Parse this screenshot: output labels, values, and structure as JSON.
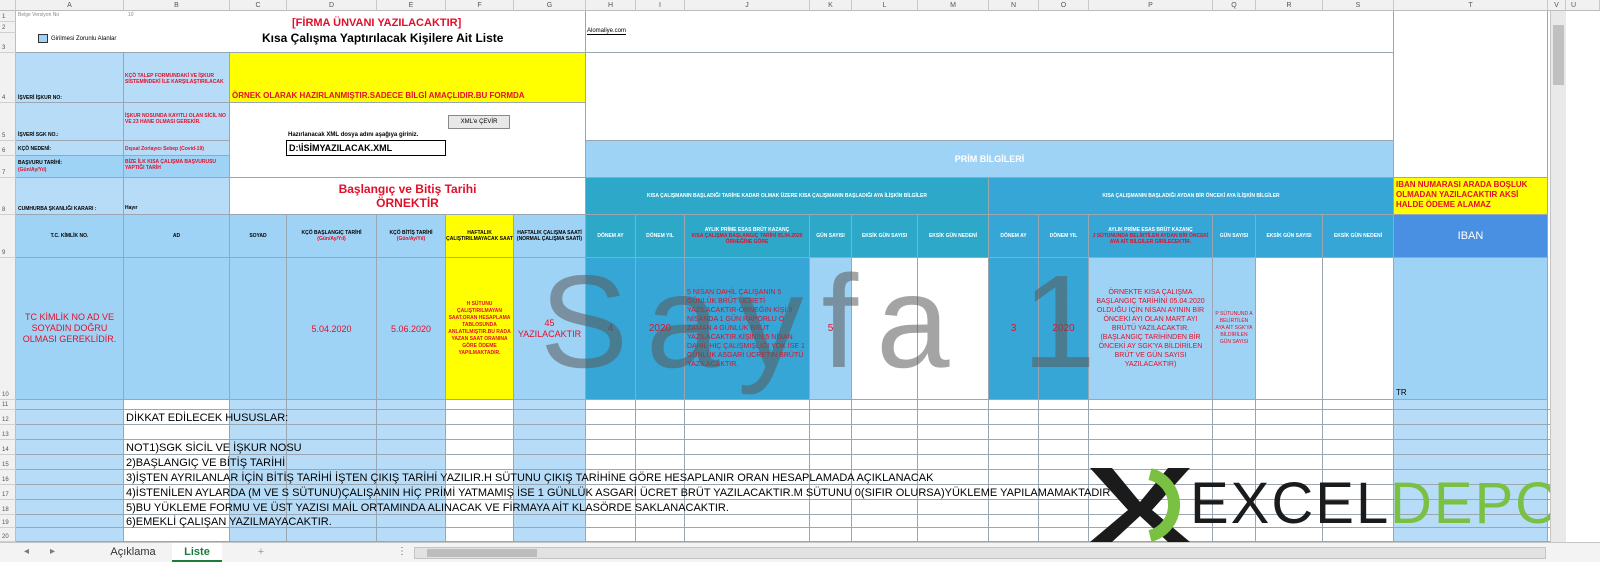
{
  "columns": [
    "A",
    "B",
    "C",
    "D",
    "E",
    "F",
    "G",
    "H",
    "I",
    "J",
    "K",
    "L",
    "M",
    "N",
    "O",
    "P",
    "Q",
    "R",
    "S",
    "T",
    "U",
    "V"
  ],
  "rows": [
    "1",
    "2",
    "3",
    "4",
    "5",
    "6",
    "7",
    "8",
    "9",
    "10",
    "11",
    "12",
    "13",
    "14",
    "15",
    "16",
    "17",
    "18",
    "19",
    "20"
  ],
  "header": {
    "tiny_top_label": "Belge Versiyon No",
    "tiny_top_value": "10",
    "required_legend": "Girilmesi Zorunlu Alanlar",
    "company_placeholder": "[FİRMA ÜNVANI YAZILACAKTIR]",
    "list_title": "Kısa Çalışma Yaptırılacak Kişilere Ait Liste",
    "site_link": "Alomaliye.com"
  },
  "left_labels": {
    "isveren_iskur_no": "İŞVERİ İŞKUR NO:",
    "isveren_sgk_no": "İŞVERİ SGK NO.:",
    "kco_nedeni": "KÇÖ NEDENİ:",
    "basvuru_tarihi": "BAŞVURU TARİHİ:",
    "basvuru_tarihi_sub": "(Gün/Ay/Yıl)",
    "cumhurbaskanligi": "CUMHURBA ŞKANLIĞI KARARI :"
  },
  "left_values": {
    "iskur_note": "KÇÖ TALEP FORMUNDAKİ VE İŞKUR SİSTEMİNDEKİ İLE KARŞILAŞTIRILACAK",
    "sgk_note": "İŞKUR NOSUNDA KAYITLI OLAN SİCİL NO VE 23 HANE OLMASI GEREKİR.",
    "kco_value": "Dışsal Zorlayıcı Sebep (Covid-19)",
    "basvuru_note": "BİZE İLK KISA ÇALIŞMA BAŞVURUSU YAPTIĞI TARİH",
    "karar_value": "Hayır"
  },
  "center": {
    "ornek_banner": "ÖRNEK OLARAK HAZIRLANMIŞTIR.SADECE BİLGİ AMAÇLIDIR.BU FORMDA",
    "xml_button": "XML'e ÇEVİR",
    "xml_label": "Hazırlanacak XML dosya adını aşağıya giriniz.",
    "xml_filename": "D:\\İSİMYAZILACAK.XML",
    "baslangic_note": "Başlangıç ve Bitiş Tarihi ÖRNEKTİR"
  },
  "prim": {
    "title": "PRİM BİLGİLERİ",
    "group1": "KISA ÇALIŞMANIN BAŞLADIĞI TARİHE KADAR OLMAK ÜZERE KISA ÇALIŞMANIN BAŞLADIĞI AYA İLİŞKİN BİLGİLER",
    "group2": "KISA ÇALIŞMANIN BAŞLADIĞI AYDAN BİR ÖNCEKİ AYA İLİŞKİN BİLGİLER",
    "iban_warning": "IBAN NUMARASI ARADA BOŞLUK OLMADAN YAZILACAKTIR AKSİ HALDE ÖDEME ALAMAZ"
  },
  "table_headers": {
    "tc": "T.C. KİMLİK NO.",
    "ad": "AD",
    "soyad": "SOYAD",
    "kco_bas": "KÇÖ BAŞLANGIÇ TARİHİ",
    "kco_bas_sub": "(Gün/Ay/Yıl)",
    "kco_bit": "KÇÖ BİTİŞ TARİHİ",
    "kco_bit_sub": "(Gün/Ay/Yıl)",
    "haftalik_calistirilmayacak": "HAFTALIK ÇALIŞTIRILMAYACAK SAAT",
    "haftalik_normal": "HAFTALIK ÇALIŞMA SAATİ (NORMAL ÇALIŞMA SAATİ)",
    "donem_ay": "DÖNEM AY",
    "donem_yil": "DÖNEM YIL",
    "aylik_prime_1": "AYLIK PRİME ESAS BRÜT KAZANÇ",
    "aylik_prime_1_red": "KISA ÇALIŞMA BAŞLANGIÇ TARİHİ 05.04.2020 ÖRNEĞİNE GÖRE",
    "gun_sayisi": "GÜN SAYISI",
    "eksik_gun_sayisi": "EKSİK GÜN SAYISI",
    "eksik_gun_nedeni": "EKSİK GÜN NEDENİ",
    "donem_ay_2": "DÖNEM AY",
    "donem_yil_2": "DÖNEM YIL",
    "aylik_prime_2": "AYLIK PRİME ESAS BRÜT KAZANÇ",
    "aylik_prime_2_red": "J SÜTUNUNDA BELİRTİLEN AYDAN BİR ÖNCEKİ AYA AİT BİLGİLER GİRİLECEKTİR.",
    "gun_sayisi_2": "GÜN SAYISI",
    "eksik_gun_sayisi_2": "EKSİK GÜN SAYISI",
    "eksik_gun_nedeni_2": "EKSİK GÜN NEDENİ",
    "iban": "IBAN"
  },
  "example_row": {
    "tc_note": "TC KİMLİK NO AD VE SOYADIN DOĞRU OLMASI GEREKLİDİR.",
    "kco_bas": "5.04.2020",
    "kco_bit": "5.06.2020",
    "h_note": "H SÜTUNU ÇALIŞTIRILMAYAN SAAT.ORAN HESAPLAMA TABLOSUNDA ANLATILMIŞTIR.BU RADA YAZAN SAAT ORANINA GÖRE ÖDEME YAPILMAKTADIR.",
    "haftalik_normal": "45 YAZILACAKTIR",
    "donem_ay": "4",
    "donem_yil": "2020",
    "brut_note": "5 NİSAN DAHİL ÇALIŞANIN 5 GÜNLÜK BRÜT ÜCRETİ YAZILACAKTIR-ÖRNEĞİN KİŞİ 3 NİSANDA 1 GÜN RAPORLU O ZAMAN 4 GÜNLÜK BRÜT YAZILACAKTIR.KİŞİNİN 5 NİSAN DAHİL HİÇ ÇALIŞMIŞLIĞI YOK İSE 1 GÜNLÜK ASGARİ ÜCRETİN BRÜTÜ YAZILACAKTIR.",
    "gun_sayisi": "5",
    "donem_ay_2": "3",
    "donem_yil_2": "2020",
    "brut_note_2": "ÖRNEKTE KISA ÇALIŞMA BAŞLANGIÇ TARİHİNİ 05.04.2020 OLDUĞU İÇİN NİSAN AYININ BİR ÖNCEKİ AYI OLAN MART AYI BRÜTÜ YAZILACAKTIR.(BAŞLANGIÇ TARİHİNDEN BİR ÖNCEKİ AY SGK'YA BİLDİRİLEN BRÜT VE GÜN SAYISI YAZILACAKTIR)",
    "gun_note_2": "P SÜTUNUND A BELİRTİLEN AYA AİT SGK'YA BİLDİRİLEN GÜN SAYISI",
    "iban_value": "TR"
  },
  "notes": [
    "DİKKAT EDİLECEK HUSUSLAR:",
    "NOT1)SGK SİCİL VE İŞKUR NOSU",
    "2)BAŞLANGIÇ VE BİTİŞ TARİHİ",
    "3)İŞTEN AYRILANLAR İÇİN BİTİŞ TARİHİ İŞTEN ÇIKIŞ TARİHİ YAZILIR.H SÜTUNU ÇIKIŞ TARİHİNE GÖRE HESAPLANIR ORAN HESAPLAMADA AÇIKLANACAK",
    "4)İSTENİLEN AYLARDA  (M VE S SÜTUNU)ÇALIŞANIN HİÇ PRİMİ YATMAMIŞ İSE 1 GÜNLÜK ASGARİ ÜCRET BRÜT YAZILACAKTIR.M SÜTUNU 0(SIFIR OLURSA)YÜKLEME YAPILAMAMAKTADIR",
    "5)BU YÜKLEME FORMU VE ÜST YAZISI MAİL ORTAMINDA ALINACAK VE FİRMAYA AİT KLASÖRDE SAKLANACAKTIR.",
    "6)EMEKLİ ÇALIŞAN YAZILMAYACAKTIR."
  ],
  "watermark": "Sayfa 1",
  "logo": {
    "left": "EXCEL",
    "right": "DEPO"
  },
  "tabs": {
    "sheet1": "Açıklama",
    "sheet2": "Liste",
    "add": "+"
  },
  "colors": {
    "light_blue": "#9fd3f5",
    "dark_teal": "#2ea8c8",
    "yellow": "#ffff00",
    "iban_blue": "#4a90e2",
    "red_text": "#e0102a",
    "logo_green": "#7ac143"
  }
}
